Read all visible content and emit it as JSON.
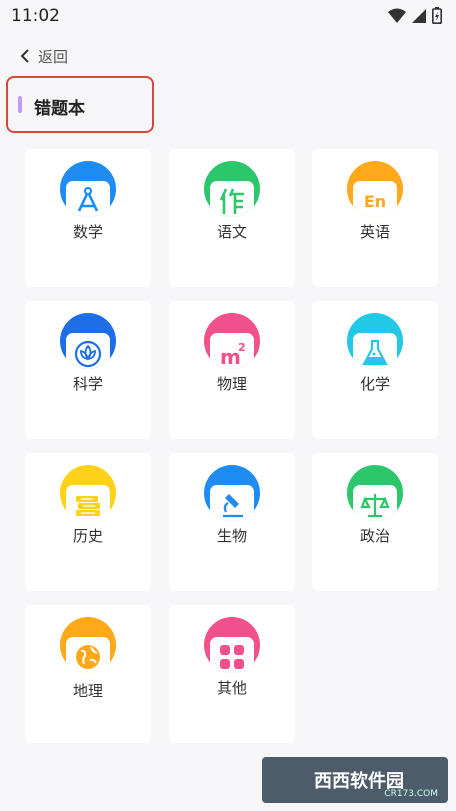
{
  "status": {
    "time": "11:02"
  },
  "nav": {
    "back_label": "返回"
  },
  "page": {
    "title": "错题本"
  },
  "subjects": [
    {
      "label": "数学",
      "color": "#1e8cf0",
      "icon": "compass-icon"
    },
    {
      "label": "语文",
      "color": "#2bc76a",
      "icon": "zuo-character-icon"
    },
    {
      "label": "英语",
      "color": "#ffa81a",
      "icon": "en-icon"
    },
    {
      "label": "科学",
      "color": "#1e6ee8",
      "icon": "leaf-icon"
    },
    {
      "label": "物理",
      "color": "#f0508c",
      "icon": "m2-icon"
    },
    {
      "label": "化学",
      "color": "#22c9e6",
      "icon": "flask-icon"
    },
    {
      "label": "历史",
      "color": "#ffd21a",
      "icon": "books-icon"
    },
    {
      "label": "生物",
      "color": "#1e8cf0",
      "icon": "microscope-icon"
    },
    {
      "label": "政治",
      "color": "#2bc76a",
      "icon": "balance-icon"
    },
    {
      "label": "地理",
      "color": "#ffa81a",
      "icon": "globe-icon"
    },
    {
      "label": "其他",
      "color": "#f0508c",
      "icon": "grid-icon"
    }
  ],
  "watermark": {
    "text": "西西软件园",
    "domain": "CR173.COM"
  }
}
